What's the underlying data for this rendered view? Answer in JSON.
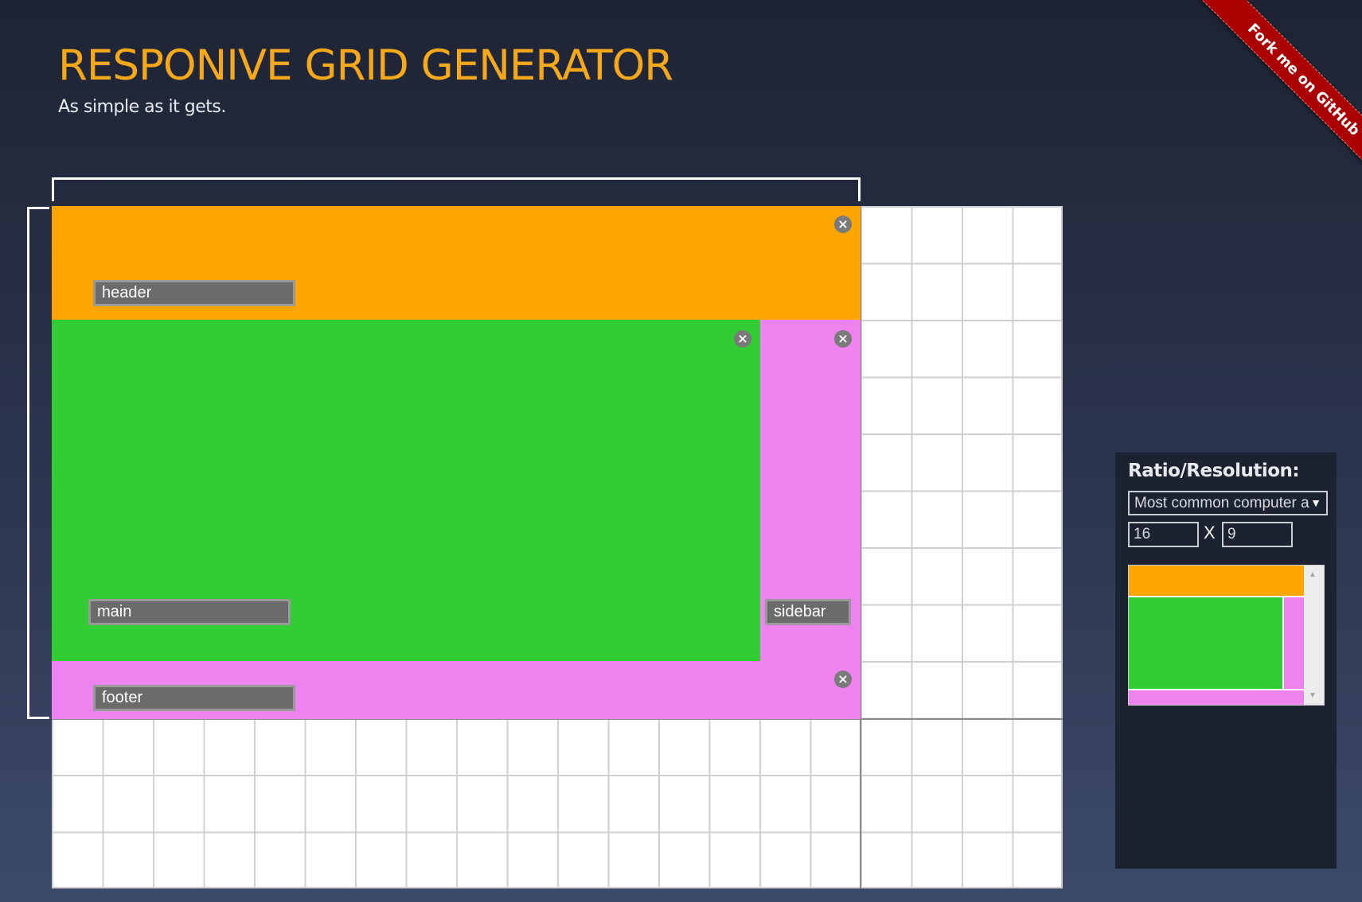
{
  "header": {
    "title": "RESPONIVE GRID GENERATOR",
    "subtitle": "As simple as it gets."
  },
  "ribbon": {
    "label": "Fork me on GitHub",
    "color": "#a00000"
  },
  "grid": {
    "columns": 20,
    "rows": 12,
    "selected_columns": 16,
    "selected_rows": 9
  },
  "areas": [
    {
      "name": "header",
      "color": "#ffa500",
      "close_icon": "close-circle-icon"
    },
    {
      "name": "main",
      "color": "#32cd32",
      "close_icon": "close-circle-icon"
    },
    {
      "name": "sidebar",
      "color": "#ee82ee",
      "close_icon": "close-circle-icon"
    },
    {
      "name": "footer",
      "color": "#ee82ee",
      "close_icon": "close-circle-icon"
    }
  ],
  "panel": {
    "heading": "Ratio/Resolution:",
    "select_value": "Most common computer a",
    "ratio_width": "16",
    "ratio_separator": "X",
    "ratio_height": "9",
    "select_icon": "caret-down-icon"
  },
  "colors": {
    "accent": "#f5a91a",
    "header_area": "#ffa500",
    "main_area": "#32cd32",
    "sidebar_area": "#ee82ee",
    "footer_area": "#ee82ee",
    "panel_bg": "#1d2231"
  }
}
